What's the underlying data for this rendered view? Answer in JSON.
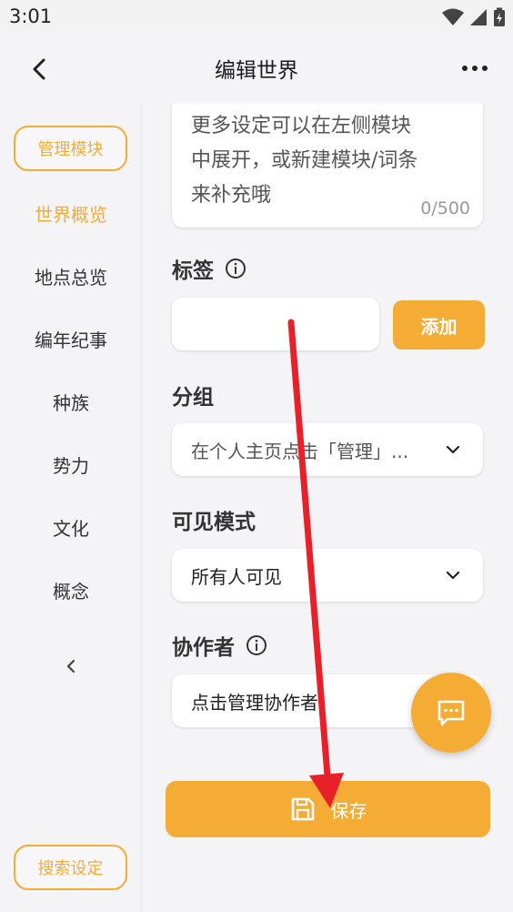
{
  "status_bar": {
    "time": "3:01"
  },
  "header": {
    "title": "编辑世界"
  },
  "sidebar": {
    "manage_label": "管理模块",
    "items": [
      {
        "label": "世界概览",
        "active": true
      },
      {
        "label": "地点总览",
        "active": false
      },
      {
        "label": "编年纪事",
        "active": false
      },
      {
        "label": "种族",
        "active": false
      },
      {
        "label": "势力",
        "active": false
      },
      {
        "label": "文化",
        "active": false
      },
      {
        "label": "概念",
        "active": false
      }
    ],
    "search_label": "搜索设定"
  },
  "description": {
    "text_lines": [
      "更多设定可以在左侧模块",
      "中展开，或新建模块/词条",
      "来补充哦"
    ],
    "counter": "0/500"
  },
  "tags": {
    "label": "标签",
    "input_value": "",
    "add_label": "添加"
  },
  "group": {
    "label": "分组",
    "value": "在个人主页点击「管理」..."
  },
  "visibility": {
    "label": "可见模式",
    "value": "所有人可见"
  },
  "collaborators": {
    "label": "协作者",
    "value": "点击管理协作者"
  },
  "save": {
    "label": "保存"
  },
  "colors": {
    "accent": "#f5ac35",
    "annotation_arrow": "#e8202a"
  }
}
